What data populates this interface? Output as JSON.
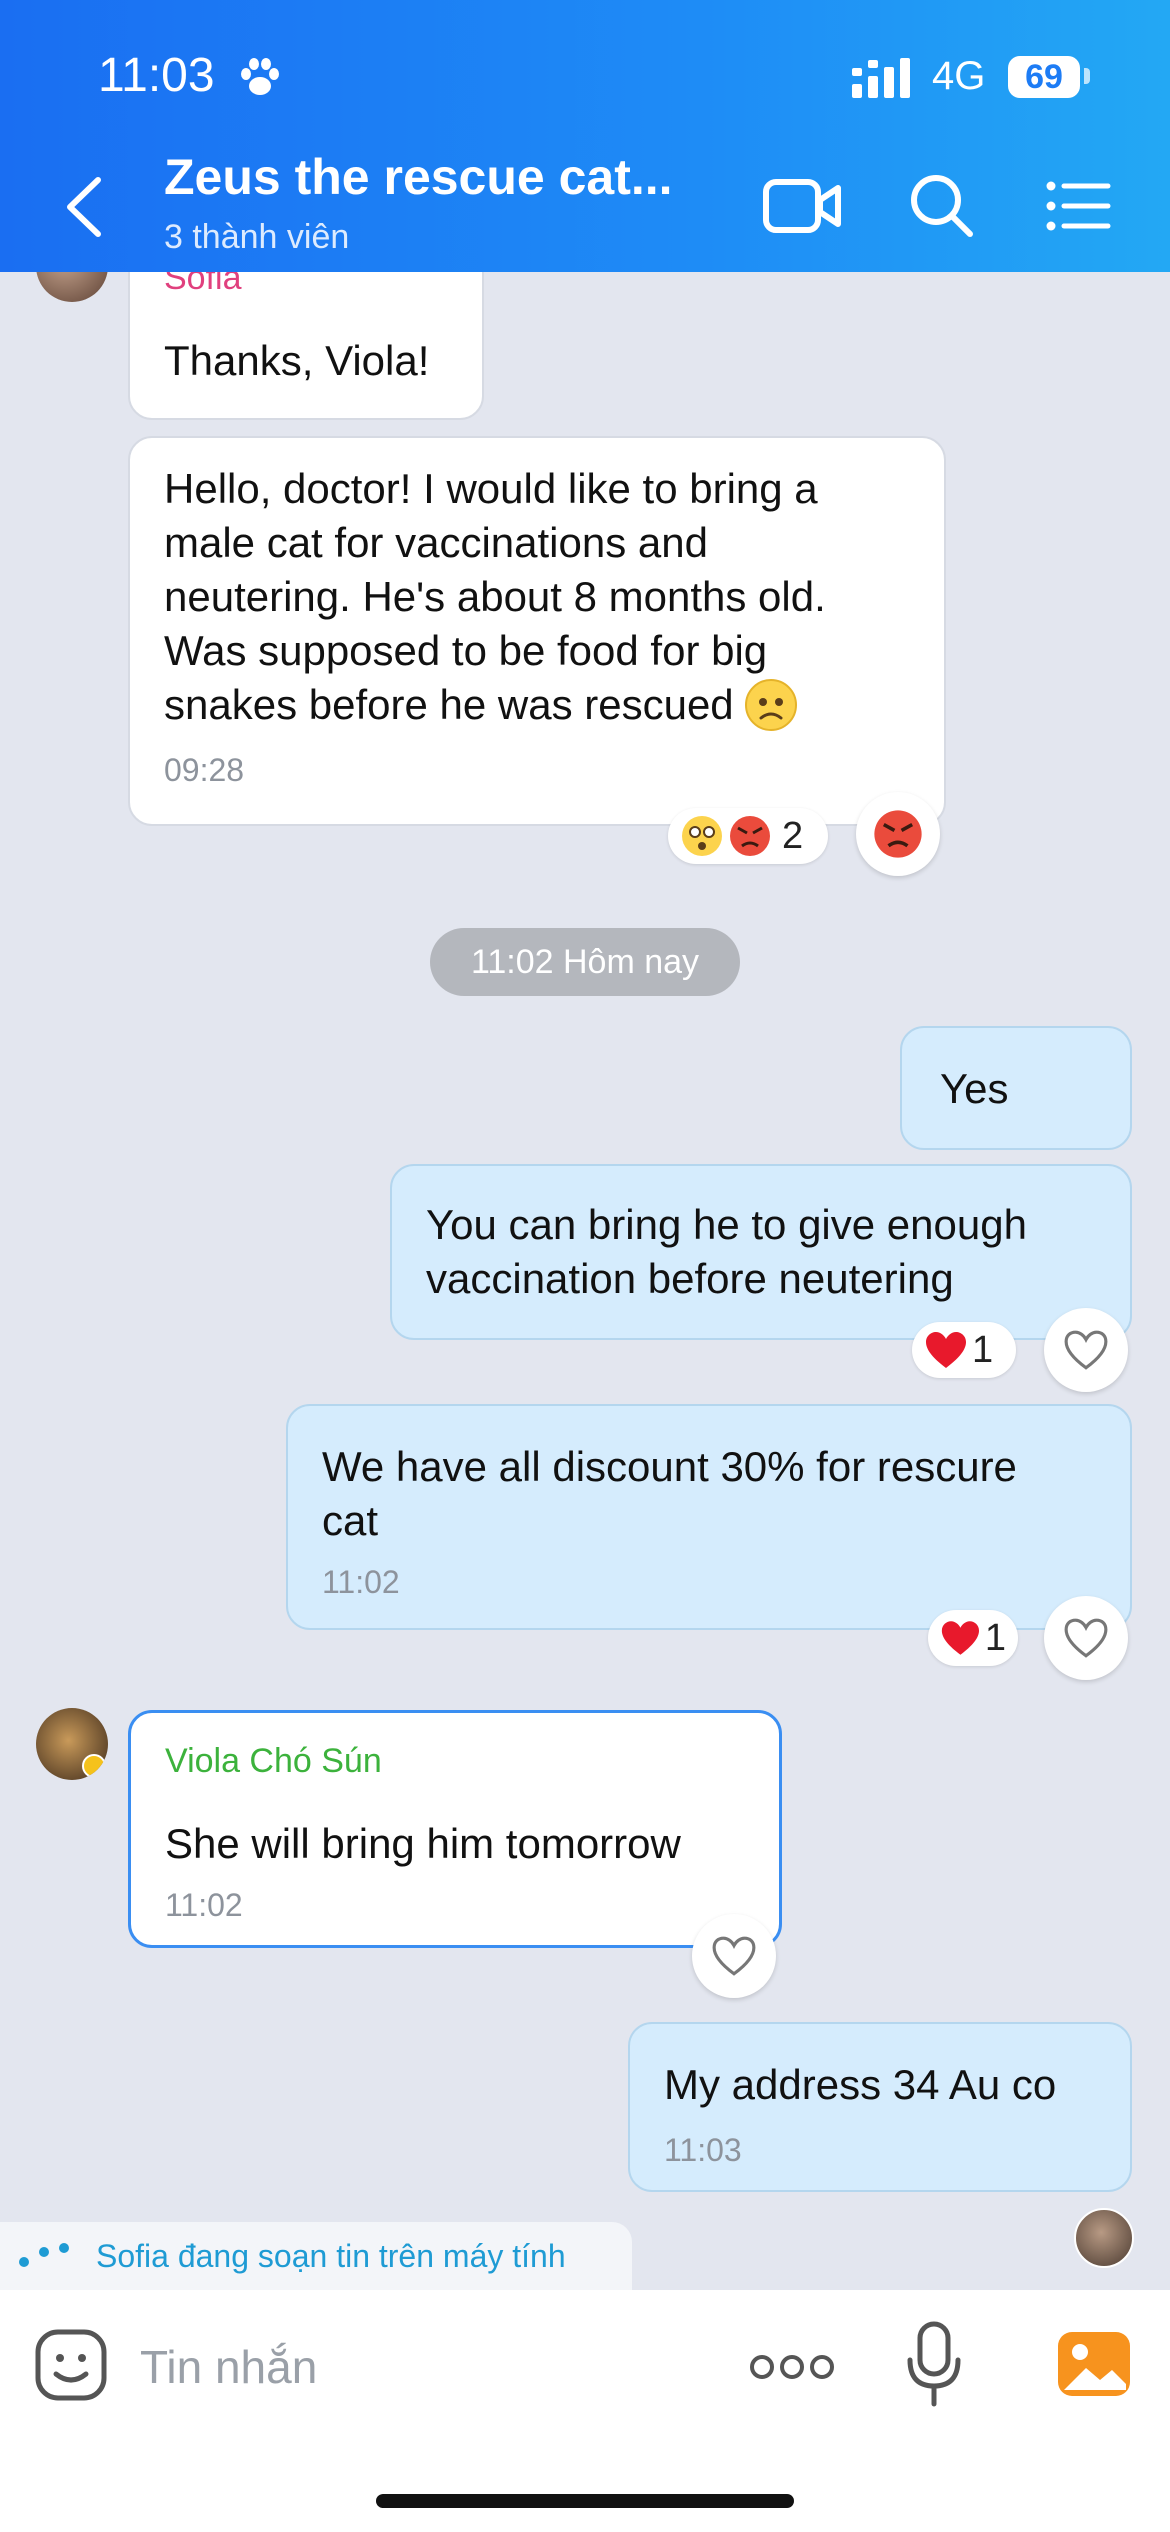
{
  "status_bar": {
    "time": "11:03",
    "network": "4G",
    "battery": "69"
  },
  "header": {
    "title": "Zeus the rescue cat...",
    "subtitle": "3 thành viên"
  },
  "messages": [
    {
      "sender": "Sofia",
      "text": "Thanks, Viola!"
    },
    {
      "text_lines": [
        "Hello, doctor! I would like to bring a",
        "male cat for vaccinations and",
        "neutering. He's about 8 months old.",
        "Was supposed to be food for big",
        "snakes before he was rescued"
      ],
      "time": "09:28",
      "reaction_count": "2"
    },
    {
      "text": "Yes"
    },
    {
      "text_lines": [
        "You can bring he to give enough",
        "vaccination before neutering"
      ],
      "reaction_count": "1"
    },
    {
      "text_lines": [
        "We have all discount 30% for rescure",
        "cat"
      ],
      "time": "11:02",
      "reaction_count": "1"
    },
    {
      "sender": "Viola Chó Sún",
      "text": "She will bring him tomorrow",
      "time": "11:02"
    },
    {
      "text": "My address 34 Au co",
      "time": "11:03"
    }
  ],
  "date_separator": "11:02 Hôm nay",
  "typing_indicator": "Sofia đang soạn tin trên máy tính",
  "input": {
    "placeholder": "Tin nhắn"
  },
  "colors": {
    "header_start": "#1a6ef2",
    "header_end": "#23a8f4",
    "out_bubble": "#d5ecfd",
    "sofia_name": "#e0407e",
    "viola_name": "#3cb23c",
    "typing_text": "#1e9bd4"
  }
}
